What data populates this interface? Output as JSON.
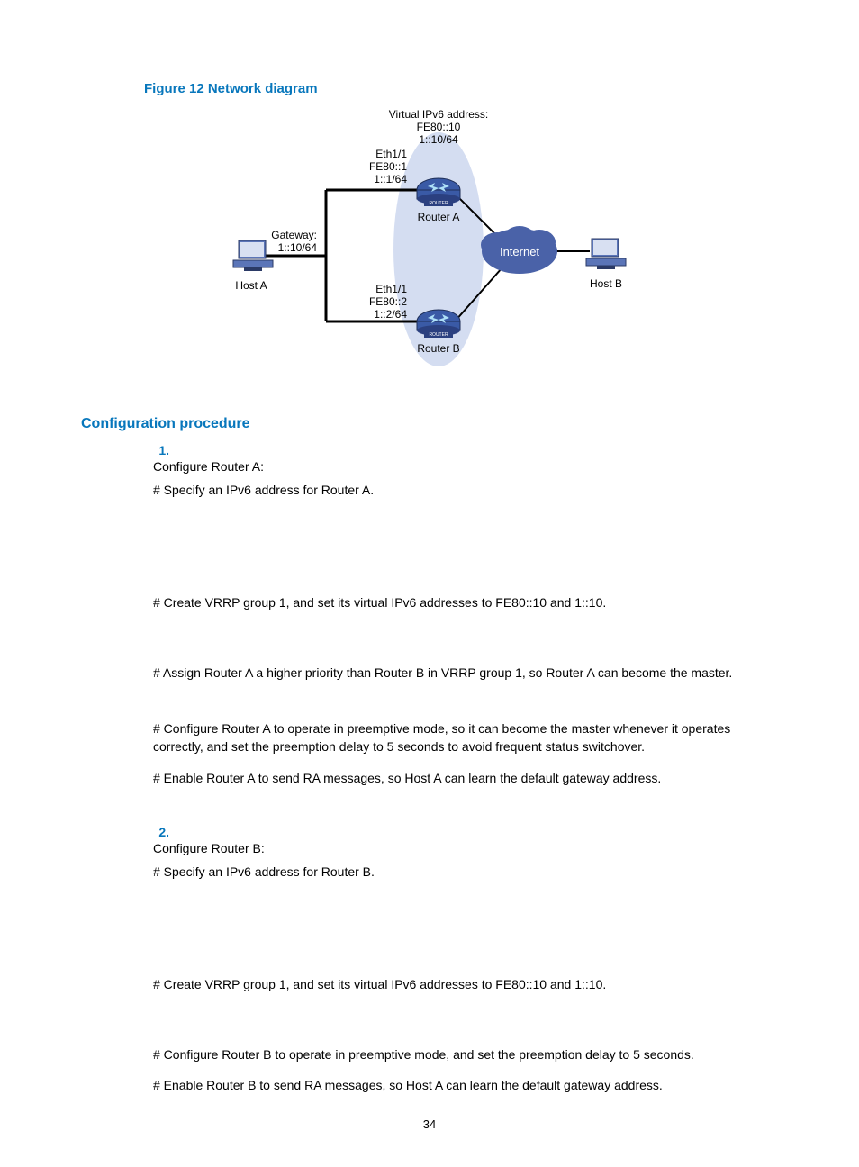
{
  "figure": {
    "caption": "Figure 12 Network diagram",
    "labels": {
      "virtual_line1": "Virtual IPv6 address:",
      "virtual_line2": "FE80::10",
      "virtual_line3": "1::10/64",
      "ra_eth": "Eth1/1",
      "ra_fe": "FE80::1",
      "ra_ip": "1::1/64",
      "rb_eth": "Eth1/1",
      "rb_fe": "FE80::2",
      "rb_ip": "1::2/64",
      "gateway_l1": "Gateway:",
      "gateway_l2": "1::10/64",
      "hostA": "Host A",
      "hostB": "Host B",
      "routerA": "Router A",
      "routerB": "Router B",
      "internet": "Internet"
    }
  },
  "section_heading": "Configuration procedure",
  "steps": [
    {
      "num": "1.",
      "title": "Configure Router A:",
      "p1": "# Specify an IPv6 address for Router A.",
      "p2": "# Create VRRP group 1, and set its virtual IPv6 addresses to FE80::10 and 1::10.",
      "p3": "# Assign Router A a higher priority than Router B in VRRP group 1, so Router A can become the master.",
      "p4": "# Configure Router A to operate in preemptive mode, so it can become the master whenever it operates correctly, and set the preemption delay to 5 seconds to avoid frequent status switchover.",
      "p5": "# Enable Router A to send RA messages, so Host A can learn the default gateway address."
    },
    {
      "num": "2.",
      "title": "Configure Router B:",
      "p1": "# Specify an IPv6 address for Router B.",
      "p2": "# Create VRRP group 1, and set its virtual IPv6 addresses to FE80::10 and 1::10.",
      "p3": "# Configure Router B to operate in preemptive mode, and set the preemption delay to 5 seconds.",
      "p4": "# Enable Router B to send RA messages, so Host A can learn the default gateway address."
    }
  ],
  "page_number": "34"
}
